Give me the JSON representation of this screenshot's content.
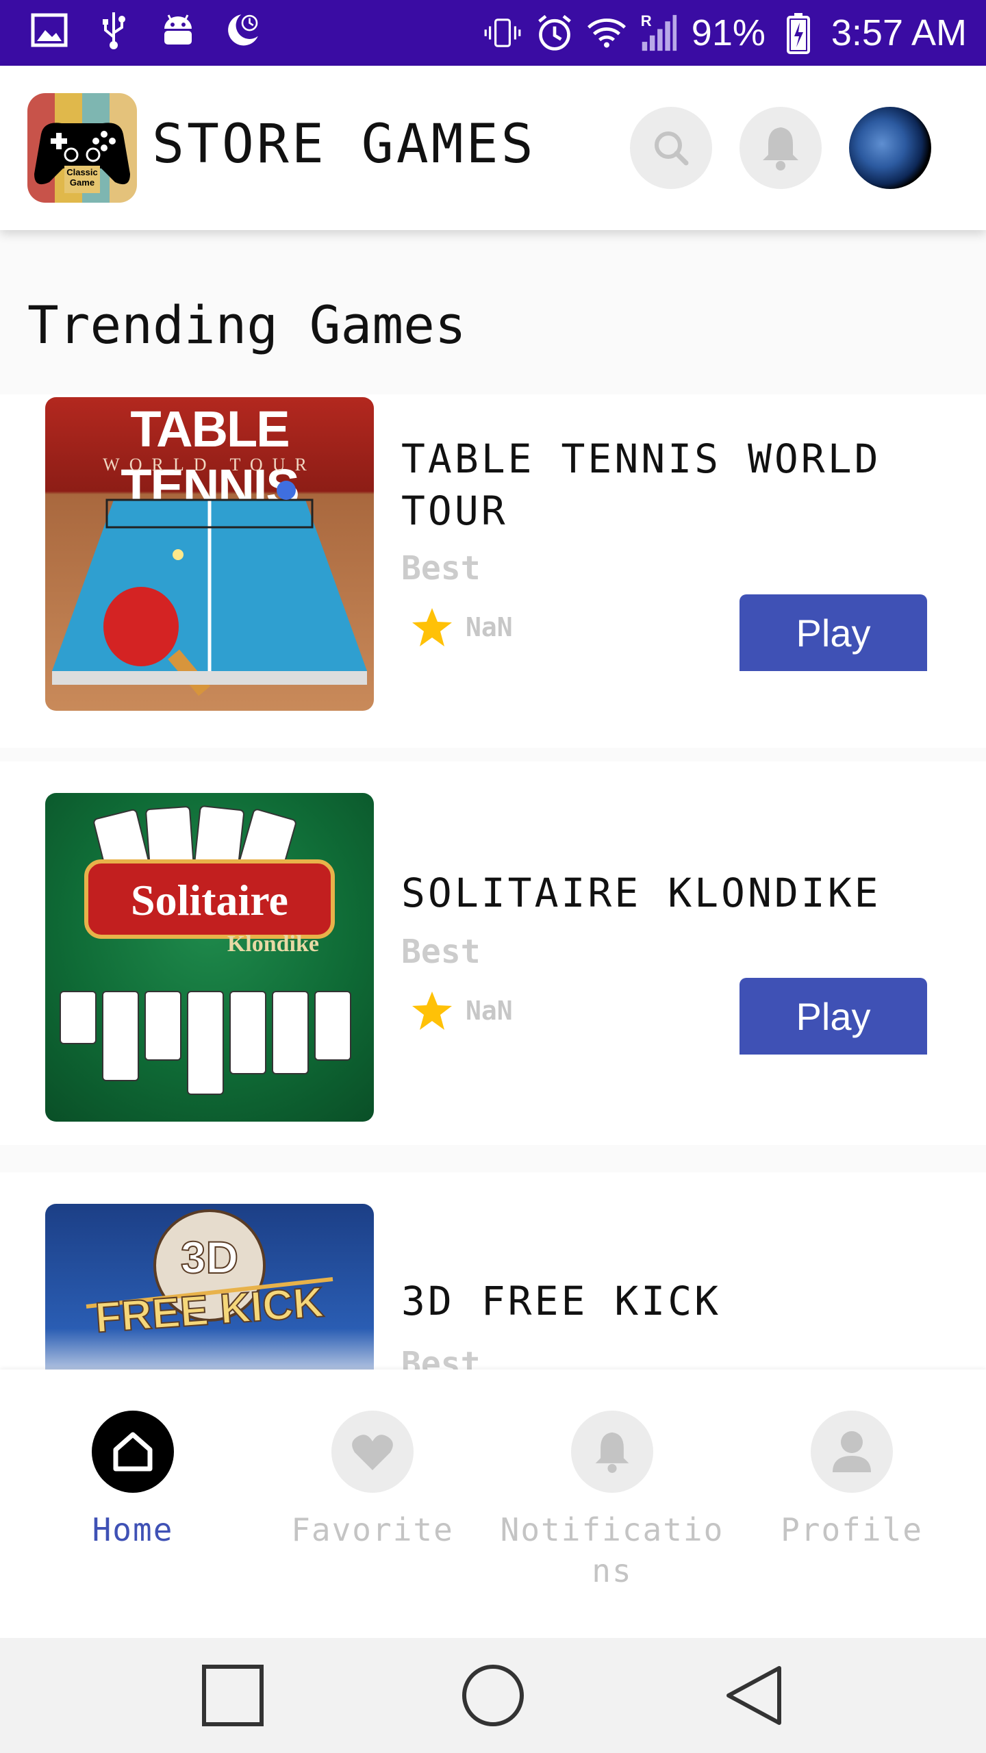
{
  "status_bar": {
    "battery": "91%",
    "time": "3:57 AM",
    "signal_label": "R",
    "left_icons": [
      "image-icon",
      "usb-icon",
      "android-icon",
      "moon-icon"
    ],
    "right_icons": [
      "vibrate-icon",
      "alarm-icon",
      "wifi-icon",
      "signal-icon",
      "battery-icon"
    ]
  },
  "app_bar": {
    "logo_text": "Classic Game",
    "title": "STORE GAMES",
    "icons": [
      "search-icon",
      "bell-icon",
      "avatar"
    ]
  },
  "section_title": "Trending Games",
  "games": [
    {
      "title": "TABLE TENNIS WORLD TOUR",
      "subtitle": "Best",
      "rating": "NaN",
      "play_label": "Play",
      "thumb_title": "TABLE TENNIS",
      "thumb_sub": "WORLD TOUR"
    },
    {
      "title": "SOLITAIRE KLONDIKE",
      "subtitle": "Best",
      "rating": "NaN",
      "play_label": "Play",
      "thumb_title": "Solitaire",
      "thumb_sub": "Klondike"
    },
    {
      "title": "3D FREE KICK",
      "subtitle": "Best",
      "thumb_title": "3D",
      "thumb_sub": "FREE KICK"
    }
  ],
  "bottom_nav": {
    "items": [
      {
        "label": "Home",
        "icon": "home-icon",
        "active": true
      },
      {
        "label": "Favorite",
        "icon": "heart-icon",
        "active": false
      },
      {
        "label": "Notifications",
        "icon": "bell-icon",
        "active": false
      },
      {
        "label": "Profile",
        "icon": "person-icon",
        "active": false
      }
    ]
  },
  "colors": {
    "status_bar": "#3a0ca3",
    "accent": "#3f51b5",
    "star": "#ffc107"
  }
}
